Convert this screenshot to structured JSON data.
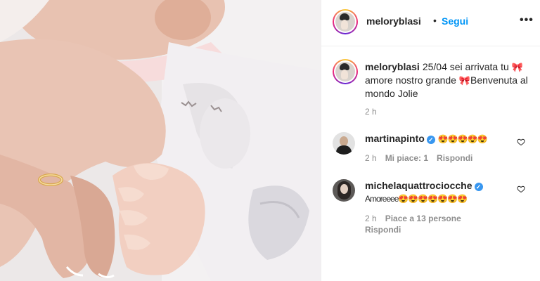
{
  "post": {
    "username": "meloryblasi",
    "separator": "•",
    "follow_label": "Segui",
    "more_label": "•••",
    "caption_parts": [
      "25/04 sei arrivata tu",
      "amore nostro grande",
      "Benvenuta al mondo Jolie"
    ],
    "caption_time": "2 h",
    "bow_emoji": "🎀"
  },
  "comments": [
    {
      "username": "martinapinto",
      "verified": true,
      "text": "😍😍😍😍😍",
      "time": "2 h",
      "likes": "Mi piace: 1",
      "reply": "Rispondi"
    },
    {
      "username": "michelaquattrociocche",
      "verified": true,
      "text": "Amoreeee😍😍😍😍😍😍😍",
      "time": "2 h",
      "likes": "Piace a 13 persone",
      "reply": "Rispondi"
    }
  ],
  "colors": {
    "link_blue": "#0095f6",
    "verified_blue": "#3897f0",
    "muted_text": "#8e8e8e",
    "primary_text": "#262626"
  },
  "icons": [
    "more-options-icon",
    "verified-badge-icon",
    "heart-icon",
    "bow-emoji-icon"
  ]
}
